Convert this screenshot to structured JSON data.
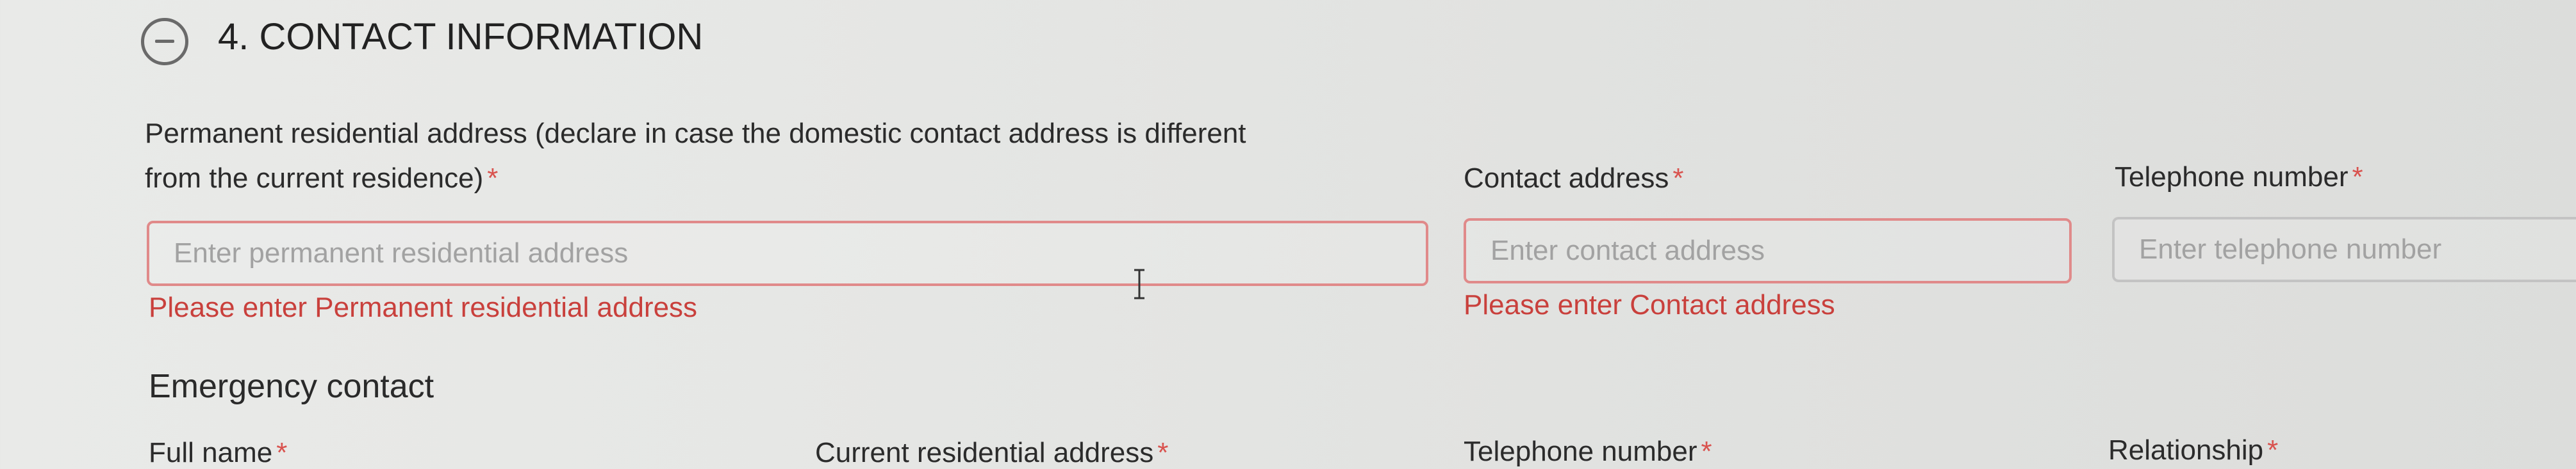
{
  "section": {
    "title": "4. CONTACT INFORMATION",
    "toggle_icon": "minus-circle-icon"
  },
  "permanent_address": {
    "label_line1": "Permanent residential address (declare in case the domestic contact address is different",
    "label_line2": "from the current residence)",
    "required": "*",
    "placeholder": "Enter permanent residential address",
    "error": "Please enter Permanent residential address"
  },
  "contact_address": {
    "label": "Contact address",
    "required": "*",
    "placeholder": "Enter contact address",
    "error": "Please enter Contact address"
  },
  "telephone": {
    "label": "Telephone number",
    "required": "*",
    "placeholder": "Enter telephone number"
  },
  "emergency": {
    "heading": "Emergency contact",
    "columns": [
      {
        "label": "Full name",
        "required": "*"
      },
      {
        "label": "Current residential address",
        "required": "*"
      },
      {
        "label": "Telephone number",
        "required": "*"
      },
      {
        "label": "Relationship",
        "required": "*"
      }
    ]
  },
  "colors": {
    "error": "#c9403c",
    "error_border": "#e08a8a",
    "required": "#d9534f"
  }
}
